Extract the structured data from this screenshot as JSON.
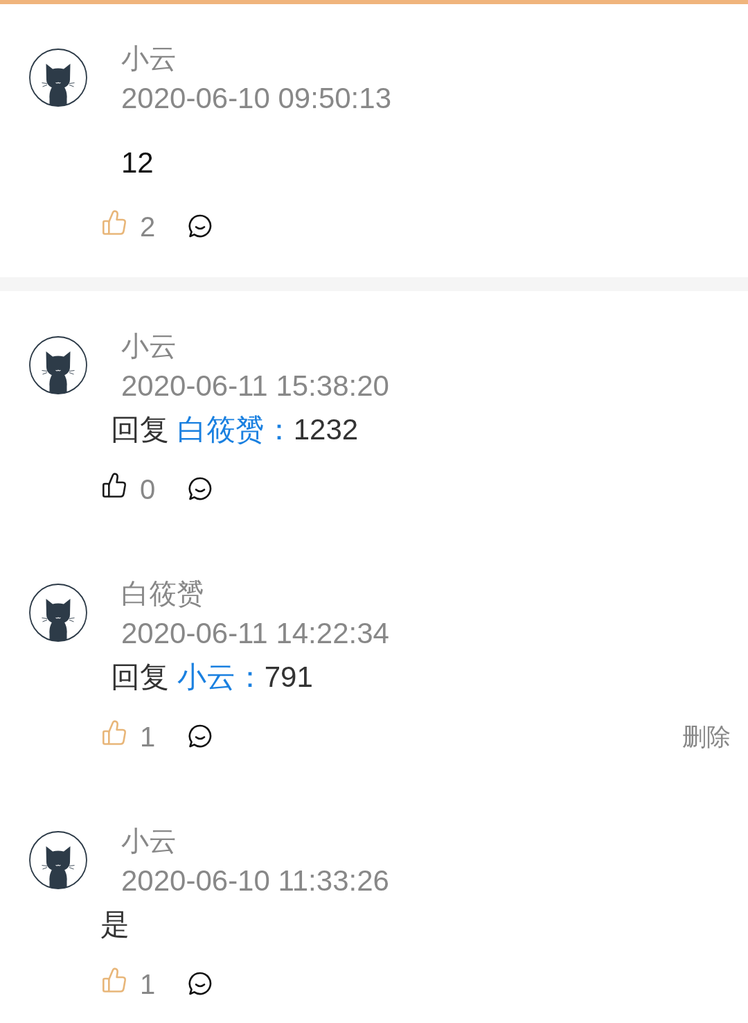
{
  "post": {
    "author": "小云",
    "time": "2020-06-10 09:50:13",
    "kind": "text",
    "text": "12",
    "liked": true,
    "likes": "2"
  },
  "replies": [
    {
      "author": "小云",
      "time": "2020-06-11 15:38:20",
      "kind": "reply",
      "reply_label": "回复",
      "reply_to": "白筱赟：",
      "text": "1232",
      "liked": false,
      "likes": "0"
    },
    {
      "author": "白筱赟",
      "time": "2020-06-11 14:22:34",
      "kind": "reply",
      "reply_label": "回复",
      "reply_to": "小云：",
      "text": "791",
      "liked": true,
      "likes": "1",
      "delete_label": "删除"
    },
    {
      "author": "小云",
      "time": "2020-06-10 11:33:26",
      "kind": "text",
      "text": "是",
      "liked": true,
      "likes": "1"
    }
  ]
}
